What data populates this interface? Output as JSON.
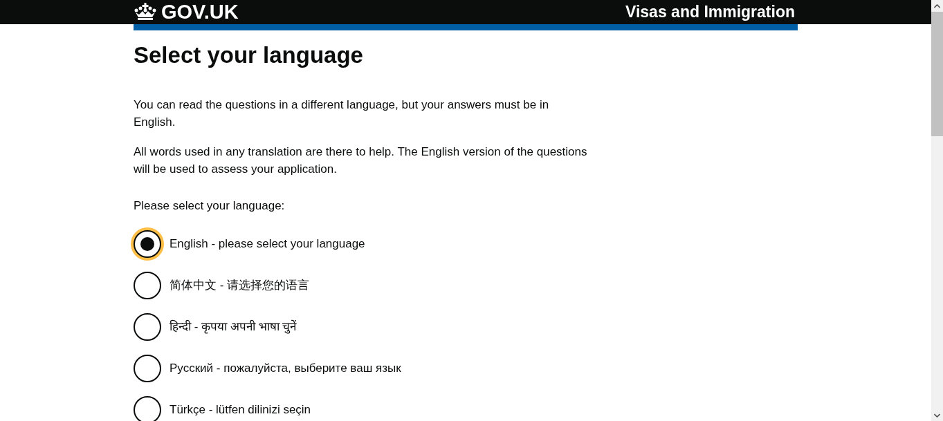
{
  "header": {
    "logo_text": "GOV.UK",
    "service_name": "Visas and Immigration"
  },
  "heading": "Select your language",
  "paragraphs": [
    "You can read the questions in a different language, but your answers must be in English.",
    "All words used in any translation are there to help. The English version of the questions will be used to assess your application."
  ],
  "question": "Please select your language:",
  "options": [
    {
      "label": "English - please select your language",
      "selected": true,
      "focused": true
    },
    {
      "label": "简体中文 - 请选择您的语言",
      "selected": false,
      "focused": false
    },
    {
      "label": "हिन्दी - कृपया अपनी भाषा चुनें",
      "selected": false,
      "focused": false
    },
    {
      "label": "Русский - пожалуйста, выберите ваш язык",
      "selected": false,
      "focused": false
    },
    {
      "label": "Türkçe - lütfen dilinizi seçin",
      "selected": false,
      "focused": false
    }
  ]
}
